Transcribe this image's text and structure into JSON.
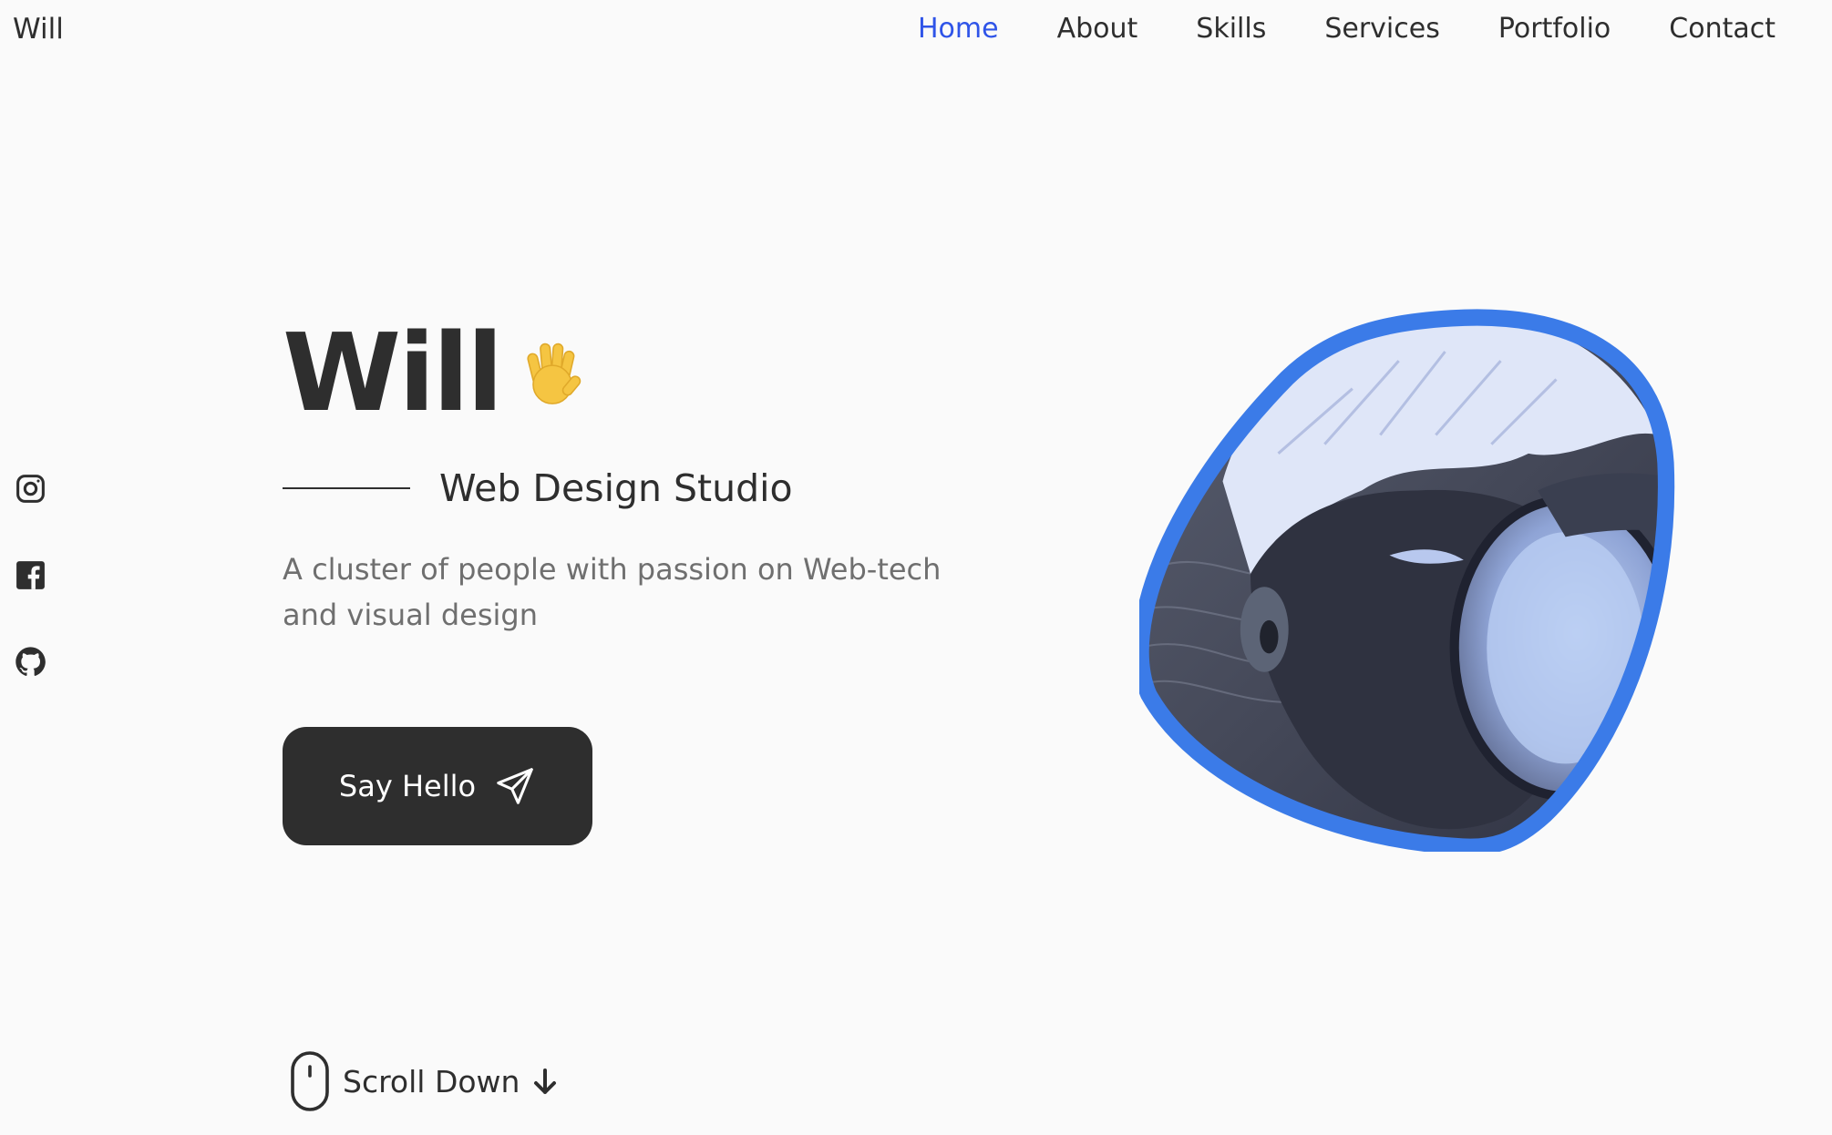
{
  "header": {
    "logo": "Will",
    "nav": [
      {
        "label": "Home",
        "active": true
      },
      {
        "label": "About",
        "active": false
      },
      {
        "label": "Skills",
        "active": false
      },
      {
        "label": "Services",
        "active": false
      },
      {
        "label": "Portfolio",
        "active": false
      },
      {
        "label": "Contact",
        "active": false
      }
    ]
  },
  "social": [
    {
      "icon": "instagram-icon"
    },
    {
      "icon": "facebook-icon"
    },
    {
      "icon": "github-icon"
    }
  ],
  "hero": {
    "name": "Will",
    "emoji": "waving-hand-icon",
    "subtitle": "Web Design Studio",
    "description": "A cluster of people with passion on Web-tech and visual design",
    "cta_label": "Say Hello",
    "cta_icon": "send-icon",
    "scroll_label": "Scroll Down",
    "profile_image": "profile-photo"
  },
  "colors": {
    "accent": "#2f54e8",
    "blob_border": "#3b7be8",
    "text": "#2e2e2e",
    "muted": "#6f6f6f",
    "background": "#fafafa",
    "button": "#2e2e2e"
  }
}
